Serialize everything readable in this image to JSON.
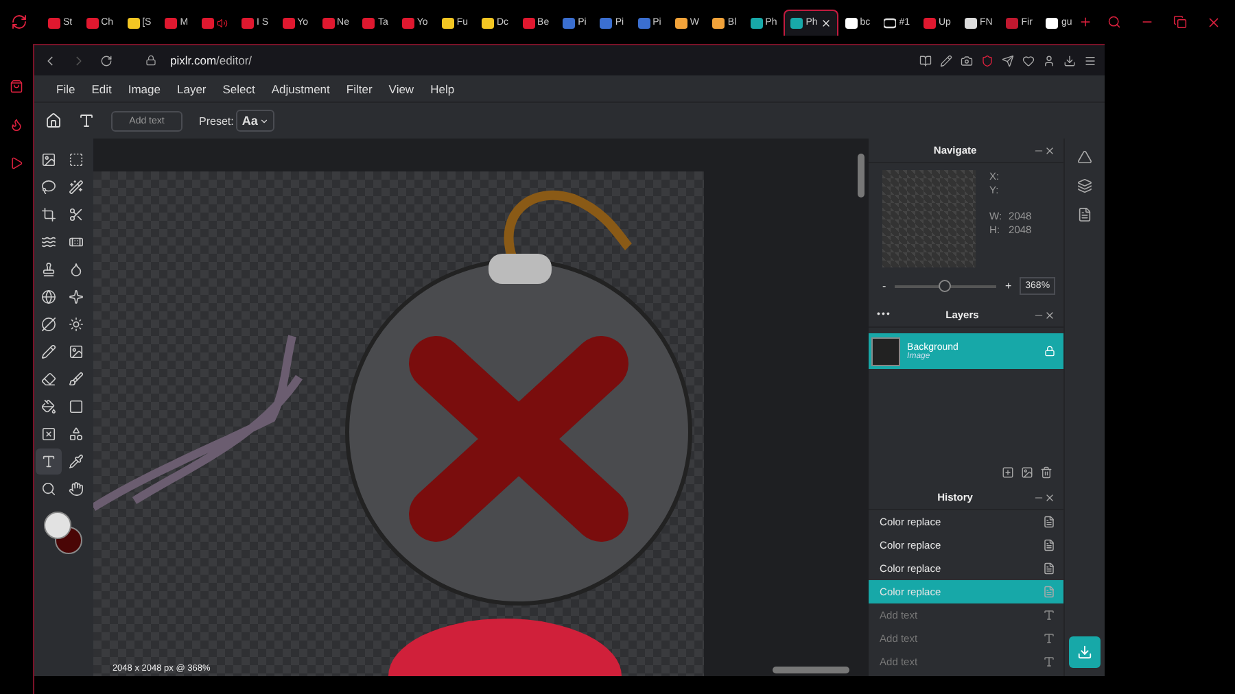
{
  "browser_tabs": [
    {
      "kind": "yt",
      "label": "St",
      "selected": false
    },
    {
      "kind": "yt",
      "label": "Ch",
      "selected": false
    },
    {
      "kind": "banana",
      "label": "[S",
      "selected": false
    },
    {
      "kind": "yt",
      "label": "M",
      "selected": false
    },
    {
      "kind": "yt-sound",
      "selected": false
    },
    {
      "kind": "yt",
      "label": "I S",
      "selected": false
    },
    {
      "kind": "yt",
      "label": "Yo",
      "selected": false
    },
    {
      "kind": "yt",
      "label": "Ne",
      "selected": false
    },
    {
      "kind": "yt",
      "label": "Ta",
      "selected": false
    },
    {
      "kind": "yt",
      "label": "Yo",
      "selected": false
    },
    {
      "kind": "banana",
      "label": "Fu",
      "selected": false
    },
    {
      "kind": "banana",
      "label": "Dc",
      "selected": false
    },
    {
      "kind": "yt",
      "label": "Be",
      "selected": false
    },
    {
      "kind": "grid",
      "label": "Pi",
      "selected": false
    },
    {
      "kind": "grid",
      "label": "Pi",
      "selected": false
    },
    {
      "kind": "grid",
      "label": "Pi",
      "selected": false
    },
    {
      "kind": "note",
      "label": "W",
      "selected": false
    },
    {
      "kind": "note",
      "label": "Bl",
      "selected": false
    },
    {
      "kind": "pixlr",
      "label": "Ph",
      "selected": false
    },
    {
      "kind": "pixlr",
      "label": "Ph",
      "selected": true
    },
    {
      "kind": "google",
      "label": "bc",
      "selected": false
    },
    {
      "kind": "ch",
      "label": "#1",
      "selected": false
    },
    {
      "kind": "yt",
      "label": "Up",
      "selected": false
    },
    {
      "kind": "bolt",
      "label": "FN",
      "selected": false
    },
    {
      "kind": "wing",
      "label": "Fir",
      "selected": false
    },
    {
      "kind": "google",
      "label": "gu",
      "selected": false
    }
  ],
  "address": {
    "host": "pixlr.com",
    "path": "/editor/"
  },
  "menu": [
    "File",
    "Edit",
    "Image",
    "Layer",
    "Select",
    "Adjustment",
    "Filter",
    "View",
    "Help"
  ],
  "options_bar": {
    "text_field": {
      "placeholder": "Add text"
    },
    "preset_label": "Preset:",
    "preset_value": "Aa"
  },
  "tools": [
    {
      "kind": "arrange",
      "selected": false
    },
    {
      "kind": "marquee",
      "selected": false
    },
    {
      "kind": "lasso",
      "selected": false
    },
    {
      "kind": "wand",
      "selected": false
    },
    {
      "kind": "crop",
      "selected": false
    },
    {
      "kind": "cut",
      "selected": false
    },
    {
      "kind": "liquify",
      "selected": false
    },
    {
      "kind": "heal",
      "selected": false
    },
    {
      "kind": "stamp",
      "selected": false
    },
    {
      "kind": "drop",
      "selected": false
    },
    {
      "kind": "globe",
      "selected": false
    },
    {
      "kind": "dots",
      "selected": false
    },
    {
      "kind": "dodge",
      "selected": false
    },
    {
      "kind": "sponge",
      "selected": false
    },
    {
      "kind": "pencil",
      "selected": false
    },
    {
      "kind": "image",
      "selected": false
    },
    {
      "kind": "eraser",
      "selected": false
    },
    {
      "kind": "brush",
      "selected": false
    },
    {
      "kind": "fill",
      "selected": false
    },
    {
      "kind": "gradient",
      "selected": false
    },
    {
      "kind": "frame",
      "selected": false
    },
    {
      "kind": "shape",
      "selected": false
    },
    {
      "kind": "text",
      "selected": true
    },
    {
      "kind": "picker",
      "selected": false
    },
    {
      "kind": "zoom",
      "selected": false
    },
    {
      "kind": "hand",
      "selected": false
    }
  ],
  "colors": [
    {
      "kind": "foreground",
      "color": "#e2e2e2"
    },
    {
      "kind": "background",
      "color": "#4a0606"
    }
  ],
  "status": "2048 x 2048 px @ 368%",
  "navigate": {
    "title": "Navigate",
    "x_label": "X:",
    "y_label": "Y:",
    "w_label": "W:",
    "w_value": "2048",
    "h_label": "H:",
    "h_value": "2048",
    "minus": "-",
    "plus": "+",
    "level": 0.48,
    "zoom_value": "368%"
  },
  "layers": {
    "title": "Layers",
    "more": "•••",
    "items": [
      {
        "name": "Background",
        "type": "Image",
        "selected": true,
        "locked": true
      }
    ]
  },
  "history": {
    "title": "History",
    "items": [
      {
        "kind": "color",
        "label": "Color replace",
        "selected": false,
        "disabled": false
      },
      {
        "kind": "color",
        "label": "Color replace",
        "selected": false,
        "disabled": false
      },
      {
        "kind": "color",
        "label": "Color replace",
        "selected": false,
        "disabled": false
      },
      {
        "kind": "color",
        "label": "Color replace",
        "selected": true,
        "disabled": false
      },
      {
        "kind": "text",
        "label": "Add text",
        "selected": false,
        "disabled": true
      },
      {
        "kind": "text",
        "label": "Add text",
        "selected": false,
        "disabled": true
      },
      {
        "kind": "text",
        "label": "Add text",
        "selected": false,
        "disabled": true
      }
    ]
  }
}
